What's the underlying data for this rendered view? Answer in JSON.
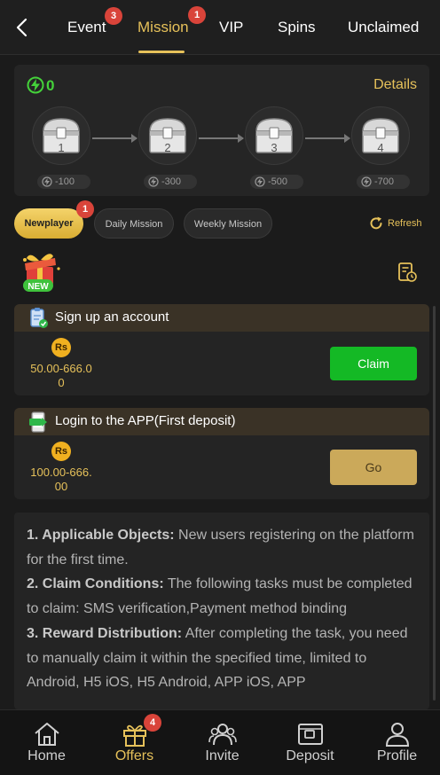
{
  "topnav": {
    "tabs": [
      {
        "label": "Event",
        "badge": "3"
      },
      {
        "label": "Mission",
        "badge": "1",
        "active": true
      },
      {
        "label": "VIP"
      },
      {
        "label": "Spins"
      },
      {
        "label": "Unclaimed"
      }
    ]
  },
  "progress": {
    "energy": "0",
    "details_label": "Details",
    "chests": [
      {
        "num": "1",
        "cost": "-100"
      },
      {
        "num": "2",
        "cost": "-300"
      },
      {
        "num": "3",
        "cost": "-500"
      },
      {
        "num": "4",
        "cost": "-700"
      }
    ]
  },
  "filters": {
    "pills": [
      {
        "label": "Newplayer",
        "badge": "1",
        "active": true
      },
      {
        "label": "Daily Mission"
      },
      {
        "label": "Weekly Mission"
      }
    ],
    "refresh_label": "Refresh"
  },
  "new_badge": "NEW",
  "tasks": [
    {
      "title": "Sign up an account",
      "currency": "Rs",
      "amount_line1": "50.00-666.0",
      "amount_line2": "0",
      "button": "Claim",
      "button_state": "claimable"
    },
    {
      "title": "Login to the APP(First deposit)",
      "currency": "Rs",
      "amount_line1": "100.00-666.",
      "amount_line2": "00",
      "button": "Go",
      "button_state": "go"
    }
  ],
  "description": {
    "items": [
      {
        "heading": "1. Applicable Objects:",
        "text": " New users registering on the platform for the first time."
      },
      {
        "heading": "2. Claim Conditions:",
        "text": " The following tasks must be completed to claim: SMS verification,Payment method binding"
      },
      {
        "heading": "3. Reward Distribution:",
        "text": " After completing the task, you need to manually claim it within the specified time, limited to Android, H5 iOS, H5 Android, APP iOS, APP"
      }
    ]
  },
  "bottomnav": {
    "items": [
      {
        "label": "Home"
      },
      {
        "label": "Offers",
        "badge": "4",
        "active": true
      },
      {
        "label": "Invite"
      },
      {
        "label": "Deposit"
      },
      {
        "label": "Profile"
      }
    ]
  },
  "colors": {
    "accent": "#e6c15a",
    "energy": "#44d23a",
    "claim": "#14b925",
    "badge": "#d9443a"
  }
}
